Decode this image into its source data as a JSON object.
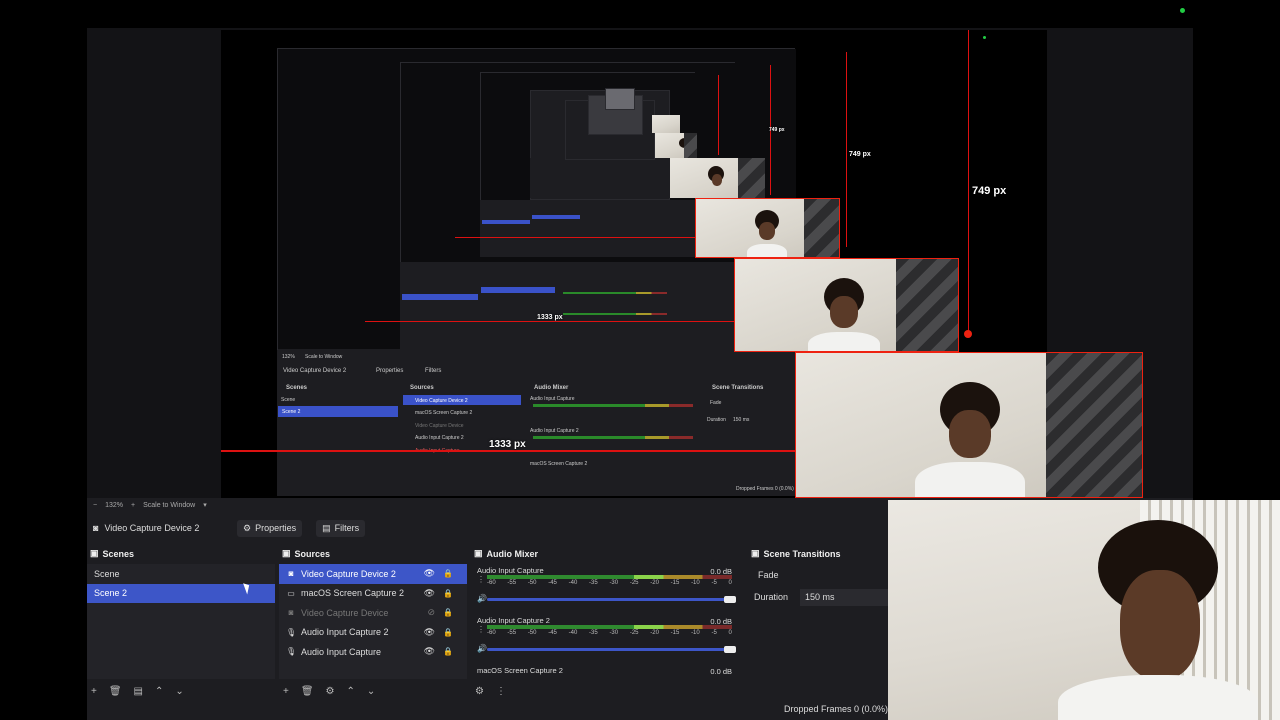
{
  "preview": {
    "measure_height_1": "749 px",
    "measure_height_2": "749 px",
    "measure_height_3": "749 px",
    "measure_width_1": "1333 px",
    "measure_width_2": "1333 px"
  },
  "nested": {
    "zoom": "132%",
    "scale": "Scale to Window",
    "title": "Video Capture Device 2",
    "properties": "Properties",
    "filters": "Filters",
    "scenes_hdr": "Scenes",
    "sources_hdr": "Sources",
    "mixer_hdr": "Audio Mixer",
    "transitions_hdr": "Scene Transitions",
    "scene_1": "Scene",
    "scene_2": "Scene 2",
    "src_1": "Video Capture Device 2",
    "src_2": "macOS Screen Capture 2",
    "src_3": "Video Capture Device",
    "src_4": "Audio Input Capture 2",
    "src_5": "Audio Input Capture",
    "mix_1": "Audio Input Capture",
    "mix_2": "Audio Input Capture 2",
    "mix_3": "macOS Screen Capture 2",
    "fade": "Fade",
    "duration": "Duration",
    "duration_val": "150 ms",
    "dropped": "Dropped Frames 0 (0.0%)"
  },
  "toolbar": {
    "zoom": "132%",
    "scale_mode": "Scale to Window"
  },
  "source_toolbar": {
    "selected_source": "Video Capture Device 2",
    "properties": "Properties",
    "filters": "Filters"
  },
  "scenes": {
    "title": "Scenes",
    "items": [
      "Scene",
      "Scene 2"
    ]
  },
  "sources": {
    "title": "Sources",
    "items": [
      "Video Capture Device 2",
      "macOS Screen Capture 2",
      "Video Capture Device",
      "Audio Input Capture 2",
      "Audio Input Capture"
    ]
  },
  "mixer": {
    "title": "Audio Mixer",
    "channels": [
      {
        "name": "Audio Input Capture",
        "db": "0.0 dB"
      },
      {
        "name": "Audio Input Capture 2",
        "db": "0.0 dB"
      },
      {
        "name": "macOS Screen Capture 2",
        "db": "0.0 dB"
      }
    ],
    "scale": [
      "-60",
      "-55",
      "-50",
      "-45",
      "-40",
      "-35",
      "-30",
      "-25",
      "-20",
      "-15",
      "-10",
      "-5",
      "0"
    ]
  },
  "transitions": {
    "title": "Scene Transitions",
    "type": "Fade",
    "duration_label": "Duration",
    "duration_value": "150 ms"
  },
  "status": {
    "dropped_frames": "Dropped Frames 0 (0.0%)"
  },
  "colors": {
    "selection": "#3d56c8",
    "guide_red": "#e21111",
    "panel": "#1d1d21"
  }
}
